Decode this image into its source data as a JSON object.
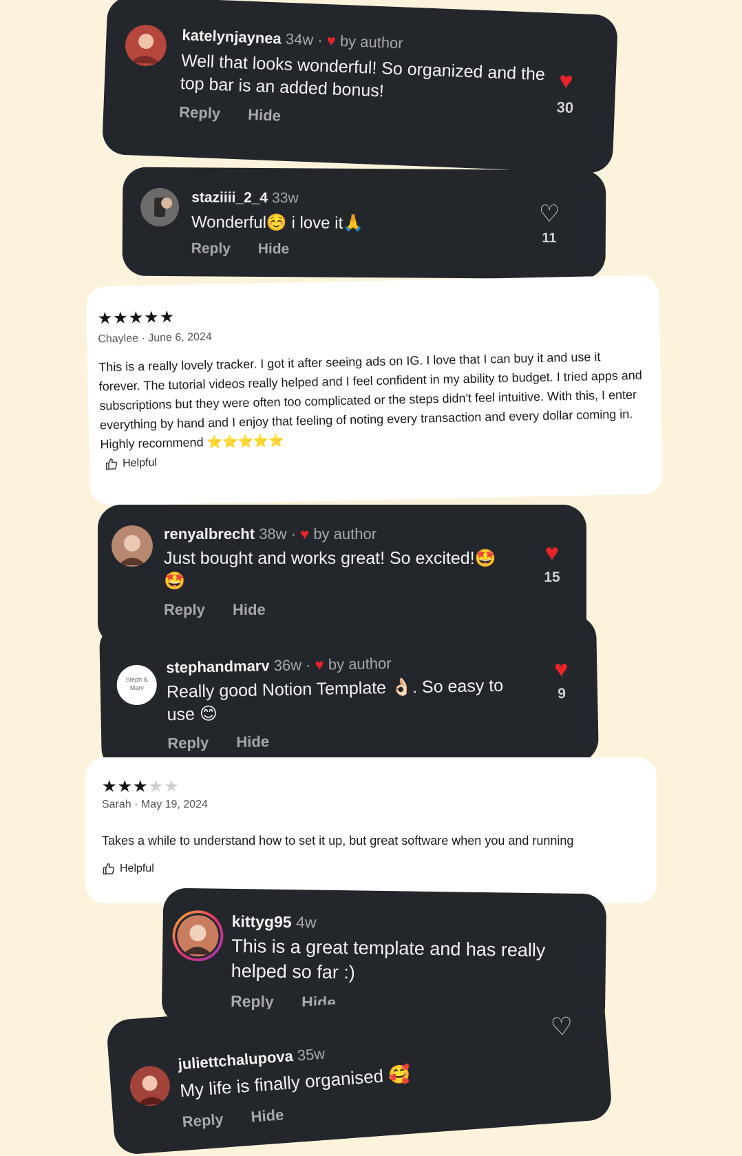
{
  "comments": [
    {
      "username": "katelynjaynea",
      "age": "34w",
      "by_author": "by author",
      "text": "Well that looks wonderful! So organized and the top bar is an added bonus!",
      "reply": "Reply",
      "hide": "Hide",
      "likes": "30",
      "liked": true,
      "avatar_color": "#b5473c"
    },
    {
      "username": "staziiii_2_4",
      "age": "33w",
      "by_author": "",
      "text": "Wonderful☺️ i love it🙏",
      "reply": "Reply",
      "hide": "Hide",
      "likes": "11",
      "liked": false,
      "avatar_color": "#6d6a6a"
    },
    {
      "username": "renyalbrecht",
      "age": "38w",
      "by_author": "by author",
      "text": "Just bought and works great! So excited!🤩 🤩",
      "reply": "Reply",
      "hide": "Hide",
      "likes": "15",
      "liked": true,
      "avatar_color": "#b88871"
    },
    {
      "username": "stephandmarv",
      "age": "36w",
      "by_author": "by author",
      "text": "Really good Notion Template 👌🏻. So easy to use 😊",
      "reply": "Reply",
      "hide": "Hide",
      "likes": "9",
      "liked": true,
      "avatar_text": "Steph & Marv"
    },
    {
      "username": "kittyg95",
      "age": "4w",
      "by_author": "",
      "text": "This is a great template and has really helped so far :)",
      "reply": "Reply",
      "hide": "Hide",
      "avatar_color": "#c97c5e"
    },
    {
      "username": "juliettchalupova",
      "age": "35w",
      "by_author": "",
      "text": "My life is finally organised 🥰",
      "reply": "Reply",
      "hide": "Hide",
      "liked": false,
      "avatar_color": "#a2443a"
    }
  ],
  "reviews": [
    {
      "stars": 5,
      "rating_text": "★★★★★",
      "author_date": "Chaylee · June 6, 2024",
      "text": "This is a really lovely tracker. I got it after seeing ads on IG. I love that I can buy it and use it forever. The tutorial videos really helped and I feel confident in my ability to budget. I tried apps and subscriptions but they were often too complicated or the steps didn't feel intuitive. With this, I enter everything by hand and I enjoy that feeling of noting every transaction and every dollar coming in. Highly recommend ⭐⭐⭐⭐⭐",
      "helpful": "Helpful"
    },
    {
      "stars": 3,
      "rating_on": "★★★",
      "rating_off": "★★",
      "author_date": "Sarah · May 19, 2024",
      "text": "Takes a while to understand how to set it up, but great software when you and running",
      "helpful": "Helpful"
    }
  ],
  "icons": {
    "heart": "♥",
    "heart_outline": "♡",
    "dot": "·"
  },
  "colors": {
    "background": "#fdf3dc",
    "card_dark": "#23272c",
    "heart_red": "#e8232a"
  }
}
